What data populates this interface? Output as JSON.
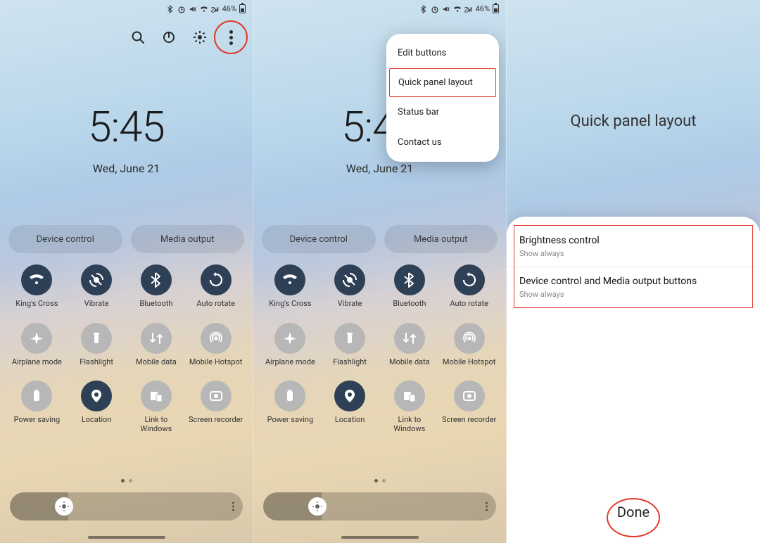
{
  "status": {
    "battery_pct": "46%"
  },
  "clock": {
    "time": "5:45",
    "date": "Wed, June 21"
  },
  "pills": {
    "device": "Device control",
    "media": "Media output"
  },
  "toggles": [
    {
      "label": "King's Cross",
      "icon": "wifi",
      "on": true
    },
    {
      "label": "Vibrate",
      "icon": "vibrate",
      "on": true
    },
    {
      "label": "Bluetooth",
      "icon": "bluetooth",
      "on": true
    },
    {
      "label": "Auto rotate",
      "icon": "rotate",
      "on": true
    },
    {
      "label": "Airplane mode",
      "icon": "airplane",
      "on": false
    },
    {
      "label": "Flashlight",
      "icon": "flash",
      "on": false
    },
    {
      "label": "Mobile data",
      "icon": "mdata",
      "on": false
    },
    {
      "label": "Mobile Hotspot",
      "icon": "hotspot",
      "on": false
    },
    {
      "label": "Power saving",
      "icon": "power",
      "on": false
    },
    {
      "label": "Location",
      "icon": "location",
      "on": true
    },
    {
      "label": "Link to Windows",
      "icon": "link",
      "on": false
    },
    {
      "label": "Screen recorder",
      "icon": "record",
      "on": false
    }
  ],
  "menu": {
    "edit": "Edit buttons",
    "layout": "Quick panel layout",
    "statusbar": "Status bar",
    "contact": "Contact us"
  },
  "s3": {
    "title": "Quick panel layout",
    "r1t": "Brightness control",
    "r1s": "Show always",
    "r2t": "Device control and Media output buttons",
    "r2s": "Show always",
    "done": "Done"
  }
}
